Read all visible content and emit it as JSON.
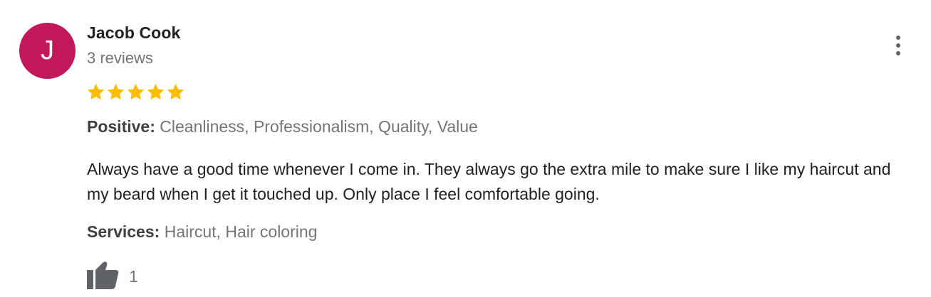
{
  "review": {
    "avatar_initial": "J",
    "avatar_color": "#c2185b",
    "author_name": "Jacob Cook",
    "review_count": "3 reviews",
    "rating": 5,
    "rating_max": 5,
    "star_color": "#fbbc04",
    "positive_label": "Positive:",
    "positive_value": "Cleanliness, Professionalism, Quality, Value",
    "text": "Always have a good time whenever I come in. They always go the extra mile to make sure I like my haircut and my beard when I get it touched up. Only place I feel comfortable going.",
    "services_label": "Services:",
    "services_value": "Haircut, Hair coloring",
    "like_count": "1",
    "more_options_icon": "more-vert-icon",
    "like_icon": "thumbs-up-icon"
  }
}
